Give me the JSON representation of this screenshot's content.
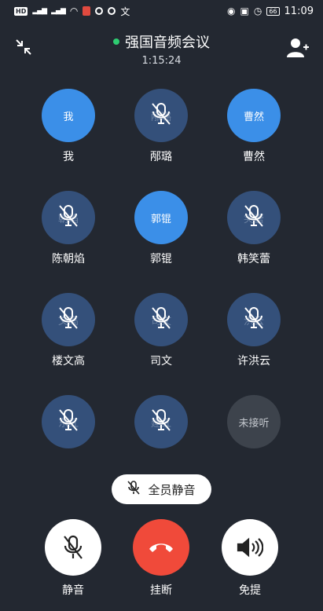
{
  "status": {
    "time": "11:09",
    "battery": "66",
    "hd": "HD"
  },
  "header": {
    "title": "强国音频会议",
    "elapsed": "1:15:24"
  },
  "participants": [
    {
      "avatar": "我",
      "name": "我",
      "state": "speaking"
    },
    {
      "avatar": "邴璐",
      "name": "邴璐",
      "state": "muted"
    },
    {
      "avatar": "曹然",
      "name": "曹然",
      "state": "speaking"
    },
    {
      "avatar": "朝焰",
      "name": "陈朝焰",
      "state": "muted"
    },
    {
      "avatar": "郭锟",
      "name": "郭锟",
      "state": "speaking"
    },
    {
      "avatar": "笑蕾",
      "name": "韩笑蕾",
      "state": "muted"
    },
    {
      "avatar": "文高",
      "name": "楼文高",
      "state": "muted"
    },
    {
      "avatar": "司文",
      "name": "司文",
      "state": "muted"
    },
    {
      "avatar": "洪云",
      "name": "许洪云",
      "state": "muted"
    },
    {
      "avatar": "东红",
      "name": "",
      "state": "muted"
    },
    {
      "avatar": "建红",
      "name": "",
      "state": "muted"
    },
    {
      "avatar": "未接听",
      "name": "",
      "state": "pending"
    }
  ],
  "mute_all_label": "全员静音",
  "controls": {
    "mute_label": "静音",
    "hangup_label": "挂断",
    "speaker_label": "免提"
  },
  "colors": {
    "background": "#232831",
    "speaking": "#3b8fe8",
    "muted": "#34507a",
    "hangup": "#f04a3a",
    "online": "#2ecc71"
  }
}
